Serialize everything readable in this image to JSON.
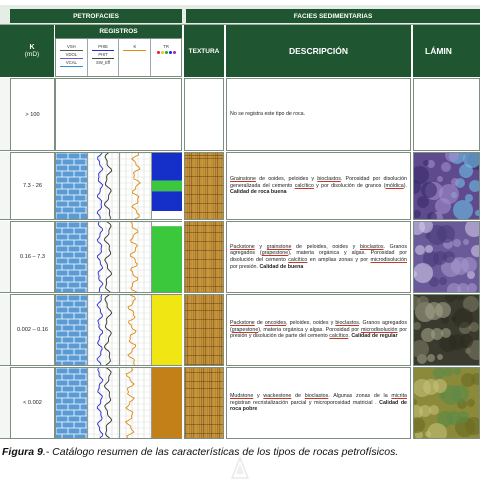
{
  "header": {
    "petrofacies": "PETROFACIES",
    "facies_sedimentarias": "FACIES SEDIMENTARIAS",
    "k_label": "K",
    "k_unit": "(mD)",
    "registros": "REGISTROS",
    "textura": "TEXTURA",
    "descripcion": "DESCRIPCIÓN",
    "laminas": "LÁMIN",
    "log_tracks": [
      {
        "lines": [
          "VSH",
          "VDOL",
          "VCAL"
        ]
      },
      {
        "lines": [
          "PHIE",
          "PHIT",
          "SW_Eff"
        ]
      },
      {
        "lines": [
          "K"
        ]
      },
      {
        "lines": [
          "TR"
        ]
      }
    ]
  },
  "rows": [
    {
      "k": "> 100",
      "desc": [
        {
          "t": "No se registra este tipo de roca.",
          "s": ""
        }
      ]
    },
    {
      "k": "7.3 - 26",
      "desc": [
        {
          "t": "Grainstone",
          "s": "u"
        },
        {
          "t": " de ooides, peloides y ",
          "s": ""
        },
        {
          "t": "bioclastos",
          "s": "u"
        },
        {
          "t": ". Porosidad por disolución generalizada del cemento ",
          "s": ""
        },
        {
          "t": "calcítico",
          "s": "u"
        },
        {
          "t": " y por disolución de granos (",
          "s": ""
        },
        {
          "t": "móldica",
          "s": "u"
        },
        {
          "t": "). ",
          "s": ""
        },
        {
          "t": "Calidad de roca buena",
          "s": "b"
        }
      ]
    },
    {
      "k": "0.16 – 7.3",
      "desc": [
        {
          "t": "Packstone",
          "s": "u"
        },
        {
          "t": " y ",
          "s": ""
        },
        {
          "t": "grainstone",
          "s": "u"
        },
        {
          "t": " de peloides, ooides y ",
          "s": ""
        },
        {
          "t": "bioclastos",
          "s": "u"
        },
        {
          "t": ". Granos agregados (",
          "s": ""
        },
        {
          "t": "grapestone",
          "s": "u"
        },
        {
          "t": "), materia orgánica y algas. Porosidad por disolución del cemento ",
          "s": ""
        },
        {
          "t": "calcítico",
          "s": "u"
        },
        {
          "t": " en amplias zonas y por ",
          "s": ""
        },
        {
          "t": "microdisolución",
          "s": "u"
        },
        {
          "t": " por presión. ",
          "s": ""
        },
        {
          "t": "Calidad de buena",
          "s": "b"
        }
      ]
    },
    {
      "k": "0.002 – 0.16",
      "desc": [
        {
          "t": "Packstone",
          "s": "u"
        },
        {
          "t": " de ",
          "s": ""
        },
        {
          "t": "oncoides",
          "s": "u"
        },
        {
          "t": ", peloides, ooides y ",
          "s": ""
        },
        {
          "t": "bioclastos",
          "s": "u"
        },
        {
          "t": ". Granos agregados (",
          "s": ""
        },
        {
          "t": "grapestone",
          "s": "u"
        },
        {
          "t": "), materia orgánica y algas. Porosidad por ",
          "s": ""
        },
        {
          "t": "microdisolución",
          "s": "u"
        },
        {
          "t": " por presión y disolución de parte del cemento ",
          "s": ""
        },
        {
          "t": "calcítico",
          "s": "u"
        },
        {
          "t": ". ",
          "s": ""
        },
        {
          "t": "Calidad de regular",
          "s": "b"
        }
      ]
    },
    {
      "k": "< 0.002",
      "desc": [
        {
          "t": "Mudstone",
          "s": "u"
        },
        {
          "t": " y ",
          "s": ""
        },
        {
          "t": "wackestone",
          "s": "u"
        },
        {
          "t": " de ",
          "s": ""
        },
        {
          "t": "bioclastos",
          "s": "u"
        },
        {
          "t": ". Algunas zonas de la ",
          "s": ""
        },
        {
          "t": "micrita",
          "s": "u"
        },
        {
          "t": " registran recristalización parcial y microporosidad matricial . ",
          "s": ""
        },
        {
          "t": "Calidad de roca pobre",
          "s": "b"
        }
      ]
    }
  ],
  "colors": {
    "header_dark": "#1f5530",
    "header_light": "#dfe8df",
    "limestone_blue": "#5b9bd5",
    "tr_blue": "#1430c8",
    "tr_green": "#3cc83c",
    "tr_yellow": "#f0e614",
    "tr_brown": "#c48018"
  },
  "caption": {
    "bold": "Figura 9",
    "rest": ".- Catálogo resumen de las características de los tipos de rocas petrofísicos."
  }
}
